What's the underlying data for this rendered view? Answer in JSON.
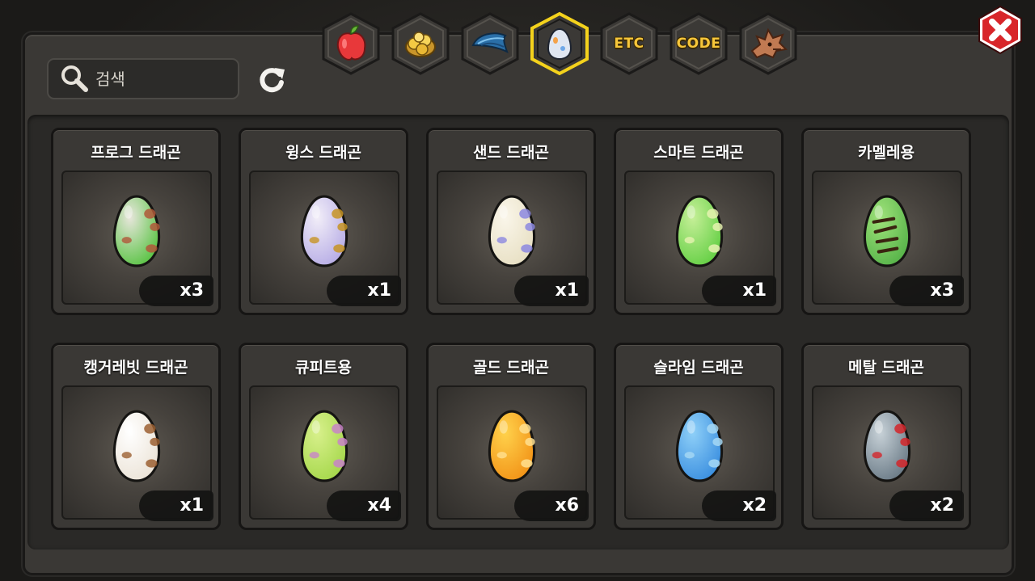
{
  "search": {
    "placeholder": "검색"
  },
  "tabs": [
    {
      "id": "fruit",
      "icon": "fruit-icon",
      "selected": false
    },
    {
      "id": "gold",
      "icon": "gold-coins-icon",
      "selected": false
    },
    {
      "id": "feather",
      "icon": "blue-feather-icon",
      "selected": false
    },
    {
      "id": "egg",
      "icon": "egg-icon",
      "selected": true
    },
    {
      "id": "etc",
      "label": "ETC",
      "selected": false
    },
    {
      "id": "code",
      "label": "CODE",
      "selected": false
    },
    {
      "id": "dragon",
      "icon": "dragon-head-icon",
      "selected": false
    }
  ],
  "colors": {
    "tab_selected_border": "#f4d21c",
    "close_button": "#d8262a",
    "panel": "#3a3835"
  },
  "eggs": [
    {
      "name": "프로그 드래곤",
      "qty": "x3",
      "base": "#5cc447",
      "light": "#e8e6dc",
      "spot": "#b0583a"
    },
    {
      "name": "윙스 드래곤",
      "qty": "x1",
      "base": "#b8aee6",
      "light": "#f2eef8",
      "spot": "#c79424"
    },
    {
      "name": "샌드 드래곤",
      "qty": "x1",
      "base": "#e8e0c4",
      "light": "#faf6ea",
      "spot": "#8c88e0"
    },
    {
      "name": "스마트 드래곤",
      "qty": "x1",
      "base": "#66d046",
      "light": "#c6ef98",
      "spot": "#e6f2b0"
    },
    {
      "name": "카멜레용",
      "qty": "x3",
      "base": "#58b44a",
      "light": "#9fe27a",
      "spot": "#3a2410"
    },
    {
      "name": "캥거레빗 드래곤",
      "qty": "x1",
      "base": "#ece4d8",
      "light": "#ffffff",
      "spot": "#9c6032"
    },
    {
      "name": "큐피트용",
      "qty": "x4",
      "base": "#a6d84c",
      "light": "#d8f08c",
      "spot": "#c884c8"
    },
    {
      "name": "골드 드래곤",
      "qty": "x6",
      "base": "#f29418",
      "light": "#ffd24c",
      "spot": "#ffe090"
    },
    {
      "name": "슬라임 드래곤",
      "qty": "x2",
      "base": "#3c90e0",
      "light": "#8fd0f8",
      "spot": "#a6d8f4"
    },
    {
      "name": "메탈 드래곤",
      "qty": "x2",
      "base": "#6c7c88",
      "light": "#c8d2d8",
      "spot": "#d4262a"
    }
  ]
}
